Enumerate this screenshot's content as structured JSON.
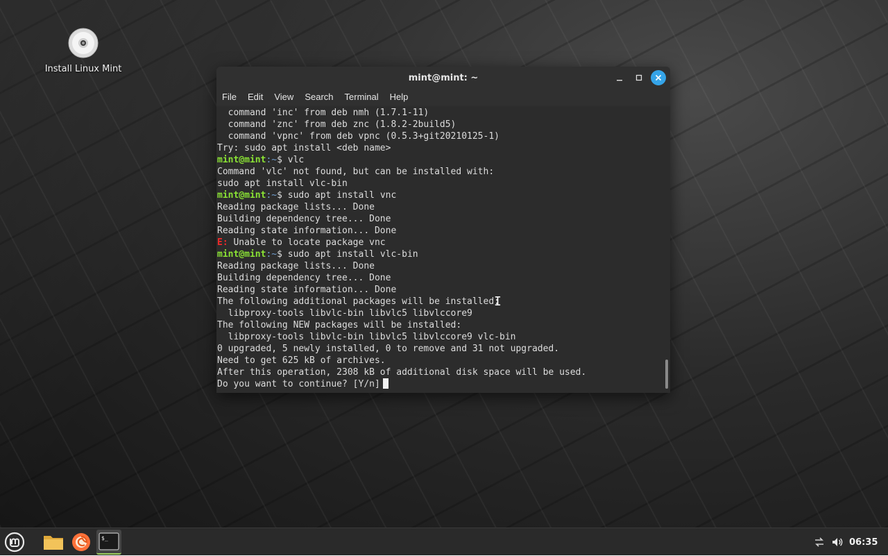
{
  "desktop": {
    "icon_label": "Install Linux Mint"
  },
  "terminal": {
    "title": "mint@mint: ~",
    "menu": [
      "File",
      "Edit",
      "View",
      "Search",
      "Terminal",
      "Help"
    ],
    "prompt_user": "mint@mint",
    "prompt_path": ":~",
    "prompt_symbol": "$ ",
    "error_prefix": "E:",
    "lines": [
      {
        "t": "out",
        "text": "  command 'inc' from deb nmh (1.7.1-11)"
      },
      {
        "t": "out",
        "text": "  command 'znc' from deb znc (1.8.2-2build5)"
      },
      {
        "t": "out",
        "text": "  command 'vpnc' from deb vpnc (0.5.3+git20210125-1)"
      },
      {
        "t": "out",
        "text": "Try: sudo apt install <deb name>"
      },
      {
        "t": "cmd",
        "text": "vlc"
      },
      {
        "t": "out",
        "text": "Command 'vlc' not found, but can be installed with:"
      },
      {
        "t": "out",
        "text": "sudo apt install vlc-bin"
      },
      {
        "t": "cmd",
        "text": "sudo apt install vnc"
      },
      {
        "t": "out",
        "text": "Reading package lists... Done"
      },
      {
        "t": "out",
        "text": "Building dependency tree... Done"
      },
      {
        "t": "out",
        "text": "Reading state information... Done"
      },
      {
        "t": "err",
        "text": " Unable to locate package vnc"
      },
      {
        "t": "cmd",
        "text": "sudo apt install vlc-bin"
      },
      {
        "t": "out",
        "text": "Reading package lists... Done"
      },
      {
        "t": "out",
        "text": "Building dependency tree... Done"
      },
      {
        "t": "out",
        "text": "Reading state information... Done"
      },
      {
        "t": "out",
        "text": "The following additional packages will be installed:"
      },
      {
        "t": "out",
        "text": "  libproxy-tools libvlc-bin libvlc5 libvlccore9"
      },
      {
        "t": "out",
        "text": "The following NEW packages will be installed:"
      },
      {
        "t": "out",
        "text": "  libproxy-tools libvlc-bin libvlc5 libvlccore9 vlc-bin"
      },
      {
        "t": "out",
        "text": "0 upgraded, 5 newly installed, 0 to remove and 31 not upgraded."
      },
      {
        "t": "out",
        "text": "Need to get 625 kB of archives."
      },
      {
        "t": "out",
        "text": "After this operation, 2308 kB of additional disk space will be used."
      },
      {
        "t": "last",
        "text": "Do you want to continue? [Y/n]"
      }
    ]
  },
  "panel": {
    "clock": "06:35"
  },
  "colors": {
    "prompt_green": "#8ae234",
    "path_blue": "#729fcf",
    "error_red": "#ef2929",
    "close_blue": "#35a4e8"
  }
}
